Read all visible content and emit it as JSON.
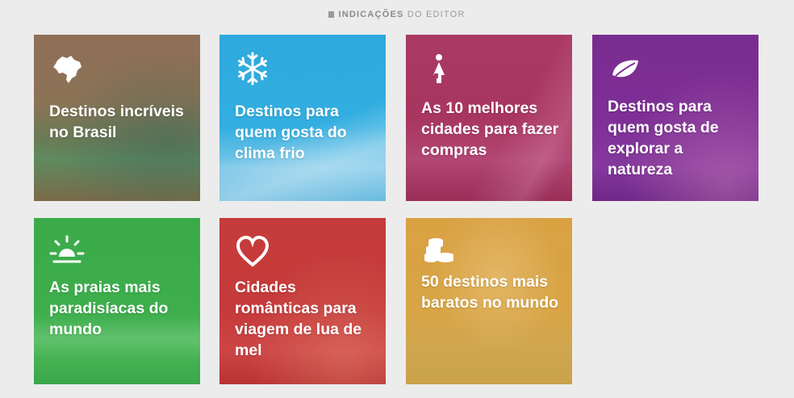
{
  "header": {
    "bold_text": "INDICAÇÕES",
    "light_text": "DO EDITOR"
  },
  "tiles": [
    {
      "title": "Destinos incríveis no Brasil",
      "icon": "brazil-map-icon",
      "color": "#8a6a4a"
    },
    {
      "title": "Destinos para quem gosta do clima frio",
      "icon": "snowflake-icon",
      "color": "#2aa8df"
    },
    {
      "title": "As 10 melhores cidades para fazer compras",
      "icon": "shopper-icon",
      "color": "#b0305c"
    },
    {
      "title": "Destinos para quem gosta de explorar a natureza",
      "icon": "leaf-icon",
      "color": "#7a2d94"
    },
    {
      "title": "As praias mais paradisíacas do mundo",
      "icon": "sunrise-icon",
      "color": "#3aaa4a"
    },
    {
      "title": "Cidades românticas para viagem de lua de mel",
      "icon": "heart-icon",
      "color": "#c73a3a"
    },
    {
      "title": "50 destinos mais baratos no mundo",
      "icon": "coins-icon",
      "color": "#d8a040"
    }
  ]
}
